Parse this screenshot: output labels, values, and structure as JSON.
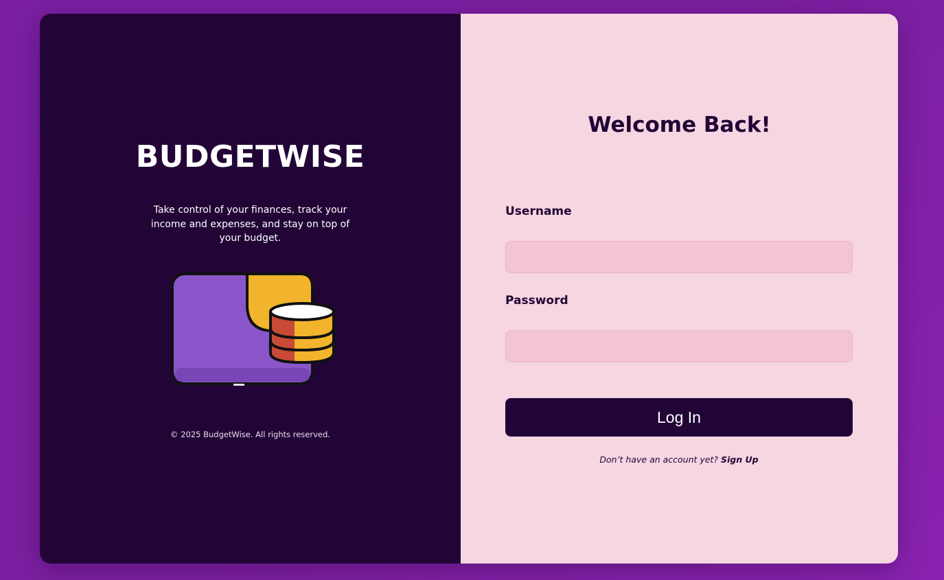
{
  "brand": {
    "name": "BUDGETWISE",
    "tagline": "Take control of your finances, track your income and expenses, and stay on top of your budget.",
    "copyright": "© 2025 BudgetWise. All rights reserved.",
    "illustration_icon": "wallet-coins-icon"
  },
  "login": {
    "title": "Welcome Back!",
    "username_label": "Username",
    "username_value": "",
    "password_label": "Password",
    "password_value": "",
    "submit_label": "Log In",
    "signup_prompt": "Don’t have an account yet?",
    "signup_link": "Sign Up"
  },
  "colors": {
    "background": "#7b1fa0",
    "left_panel": "#220536",
    "right_panel": "#f5d6e1",
    "input_fill": "#f3c4d5",
    "button": "#220536",
    "wallet_purple": "#8a56c9",
    "wallet_yellow": "#f2b42c",
    "coin_red": "#c94a36"
  }
}
